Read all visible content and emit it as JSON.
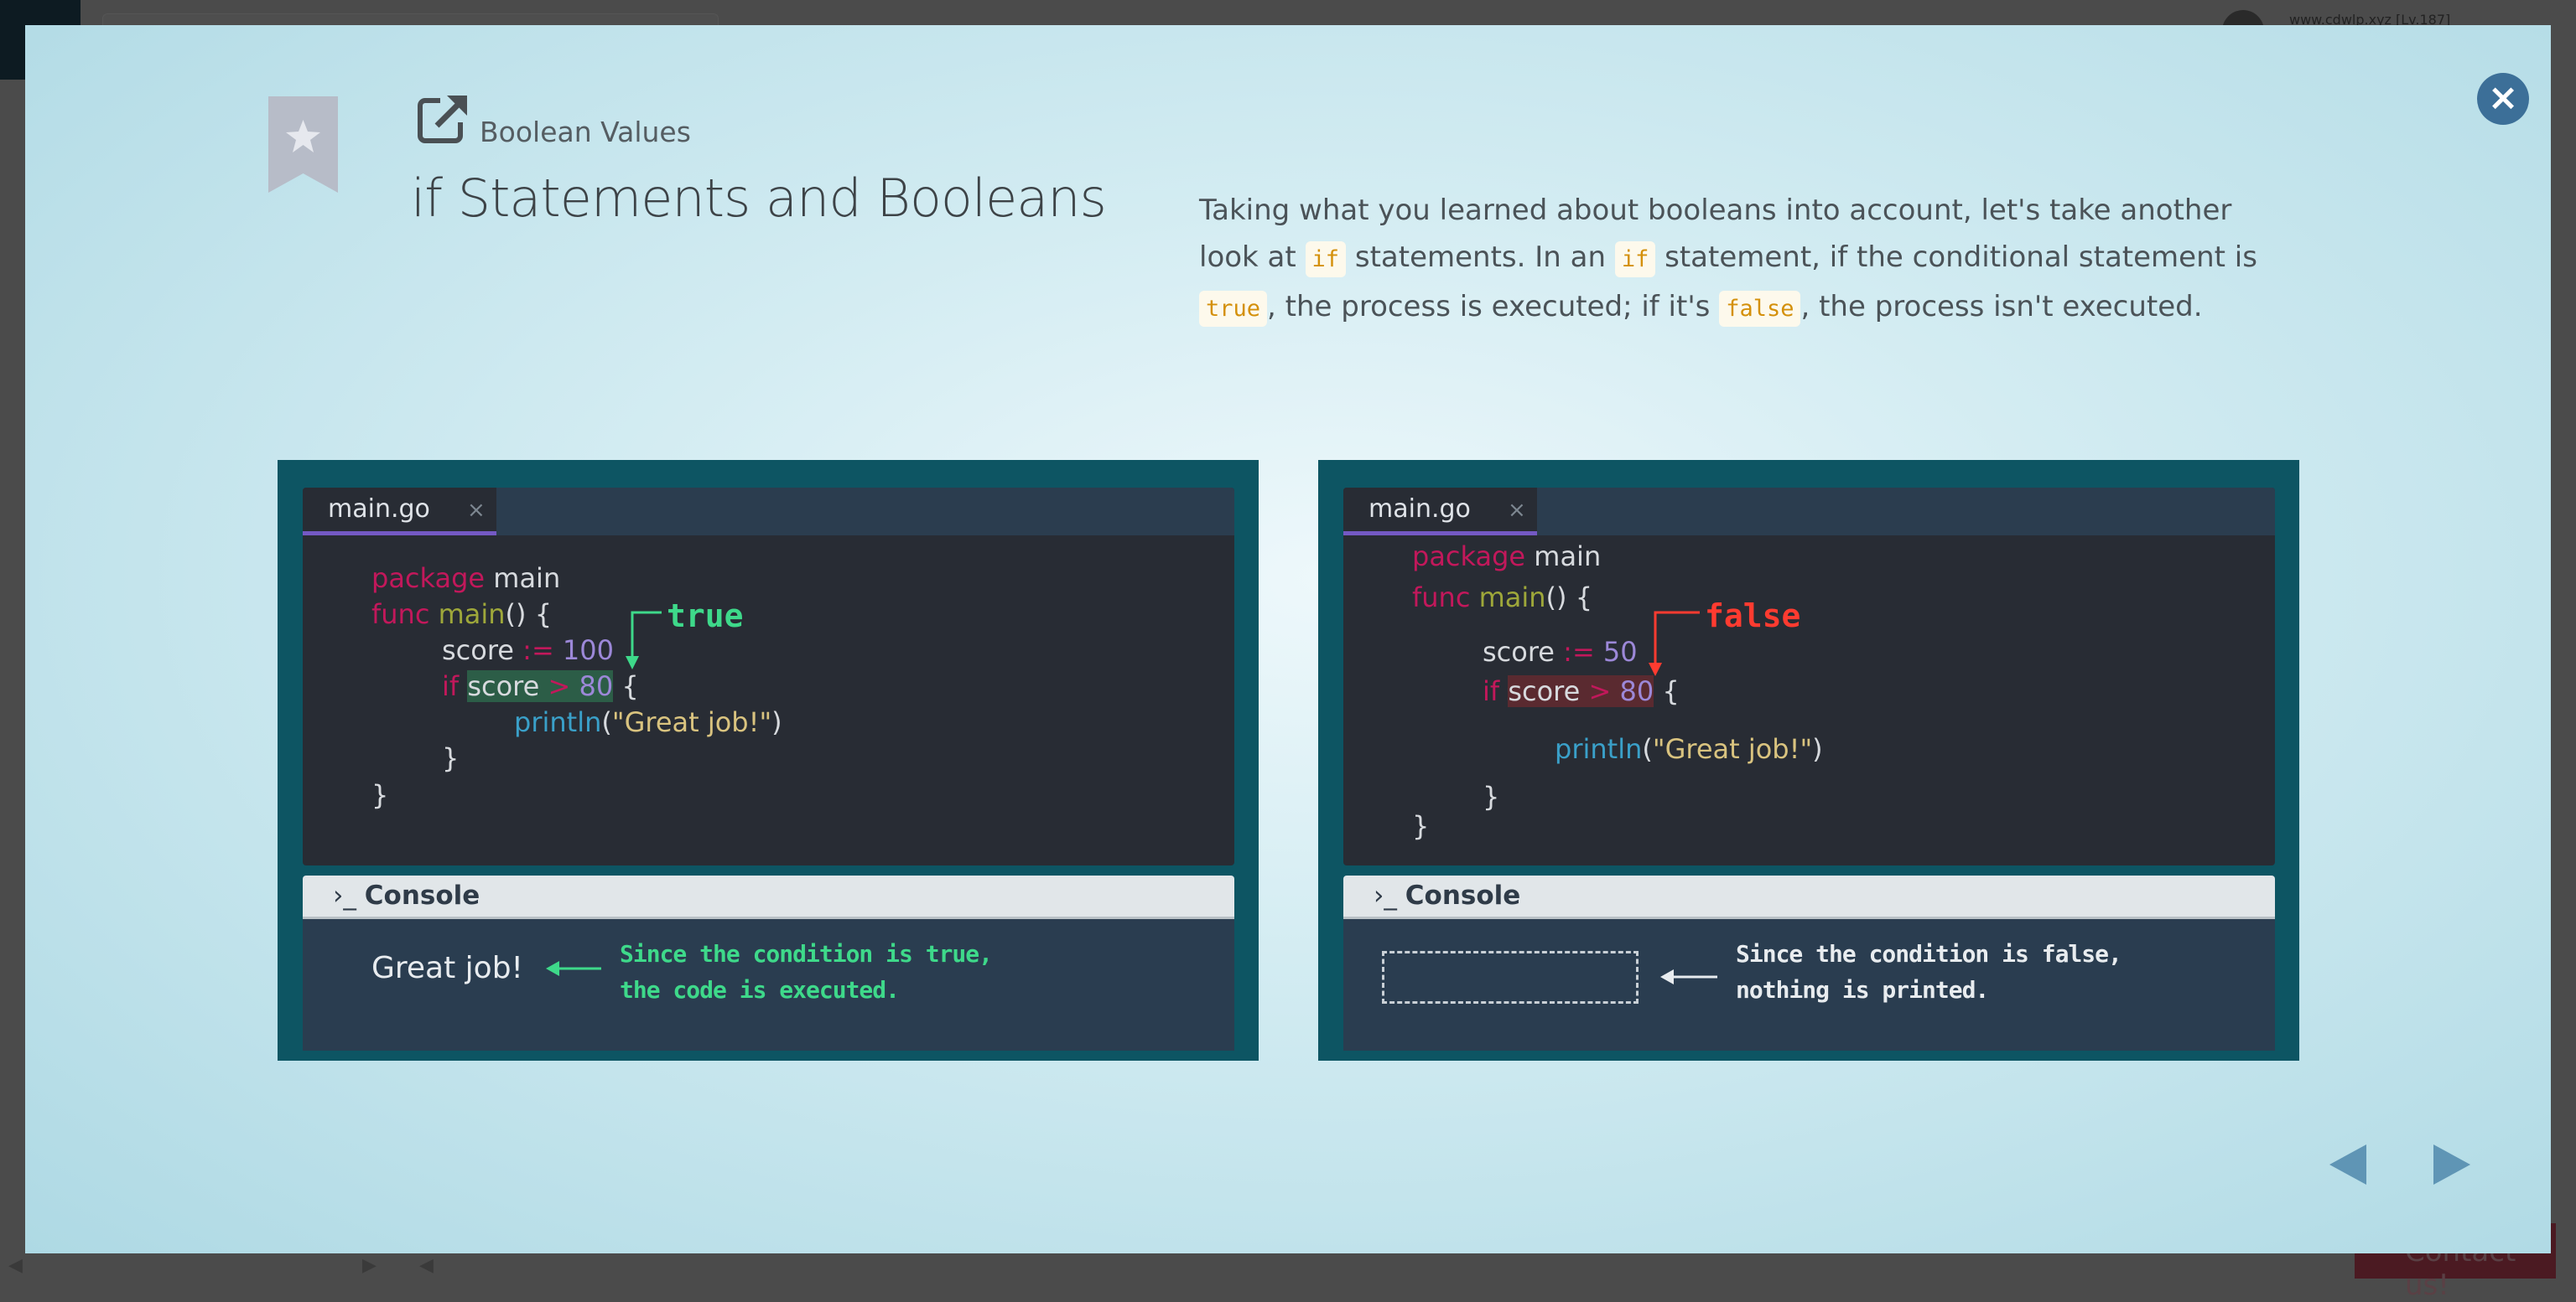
{
  "background": {
    "username": "www.cdwlp.xyz [Lv.187]",
    "contact_label": "Contact us!"
  },
  "modal": {
    "close_icon": "close-circle-icon",
    "breadcrumb": "Boolean Values",
    "title": "if Statements and Booleans",
    "description": [
      {
        "t": "Taking what you learned about booleans into account, let's take another look at "
      },
      {
        "code": "if"
      },
      {
        "t": " statements. In an "
      },
      {
        "code": "if"
      },
      {
        "t": " statement, if the conditional statement is "
      },
      {
        "code": "true"
      },
      {
        "t": ", the process is executed; if it's "
      },
      {
        "code": "false"
      },
      {
        "t": ", the process isn't executed."
      }
    ],
    "colors": {
      "accent_true": "#3ed98a",
      "accent_false": "#ff3b30",
      "panel_bg": "#0d5563"
    }
  },
  "panels": [
    {
      "tab": "main.go",
      "close_glyph": "×",
      "label": "true",
      "code": [
        [
          [
            "package",
            "kw"
          ],
          [
            " main",
            ""
          ]
        ],
        [
          [
            "func",
            "kw"
          ],
          [
            " ",
            ""
          ],
          [
            "main",
            "fn"
          ],
          [
            "() {",
            ""
          ]
        ],
        [
          [
            "score ",
            ""
          ],
          [
            ":=",
            "op"
          ],
          [
            " ",
            ""
          ],
          [
            "100",
            "num"
          ]
        ],
        [
          [
            "if",
            "kw"
          ],
          [
            " ",
            ""
          ],
          [
            "score ",
            "hl"
          ],
          [
            "> ",
            "hl op"
          ],
          [
            "80",
            "hl num"
          ],
          [
            " {",
            ""
          ]
        ],
        [
          [
            "println",
            "pl"
          ],
          [
            "(",
            ""
          ],
          [
            "\"Great job!\"",
            "str"
          ],
          [
            ")",
            ""
          ]
        ],
        [
          [
            "}",
            ""
          ]
        ],
        [
          [
            "}",
            ""
          ]
        ]
      ],
      "console_label": "Console",
      "output": "Great job!",
      "note": [
        "Since the condition is true,",
        "the code is executed."
      ]
    },
    {
      "tab": "main.go",
      "close_glyph": "×",
      "label": "false",
      "code": [
        [
          [
            "package",
            "kw"
          ],
          [
            " main",
            ""
          ]
        ],
        [
          [
            "func",
            "kw"
          ],
          [
            " ",
            ""
          ],
          [
            "main",
            "fn"
          ],
          [
            "() {",
            ""
          ]
        ],
        [
          [
            "score ",
            ""
          ],
          [
            ":=",
            "op"
          ],
          [
            " ",
            ""
          ],
          [
            "50",
            "num"
          ]
        ],
        [
          [
            "if",
            "kw"
          ],
          [
            " ",
            ""
          ],
          [
            "score ",
            "hl"
          ],
          [
            "> ",
            "hl op"
          ],
          [
            "80",
            "hl num"
          ],
          [
            " {",
            ""
          ]
        ],
        [
          [
            "println",
            "pl"
          ],
          [
            "(",
            ""
          ],
          [
            "\"Great job!\"",
            "str"
          ],
          [
            ")",
            ""
          ]
        ],
        [
          [
            "}",
            ""
          ]
        ],
        [
          [
            "}",
            ""
          ]
        ]
      ],
      "console_label": "Console",
      "output": "",
      "note": [
        "Since the condition is false,",
        "nothing is printed."
      ]
    }
  ],
  "navigation": {
    "prev_icon": "triangle-left-icon",
    "next_icon": "triangle-right-icon"
  }
}
